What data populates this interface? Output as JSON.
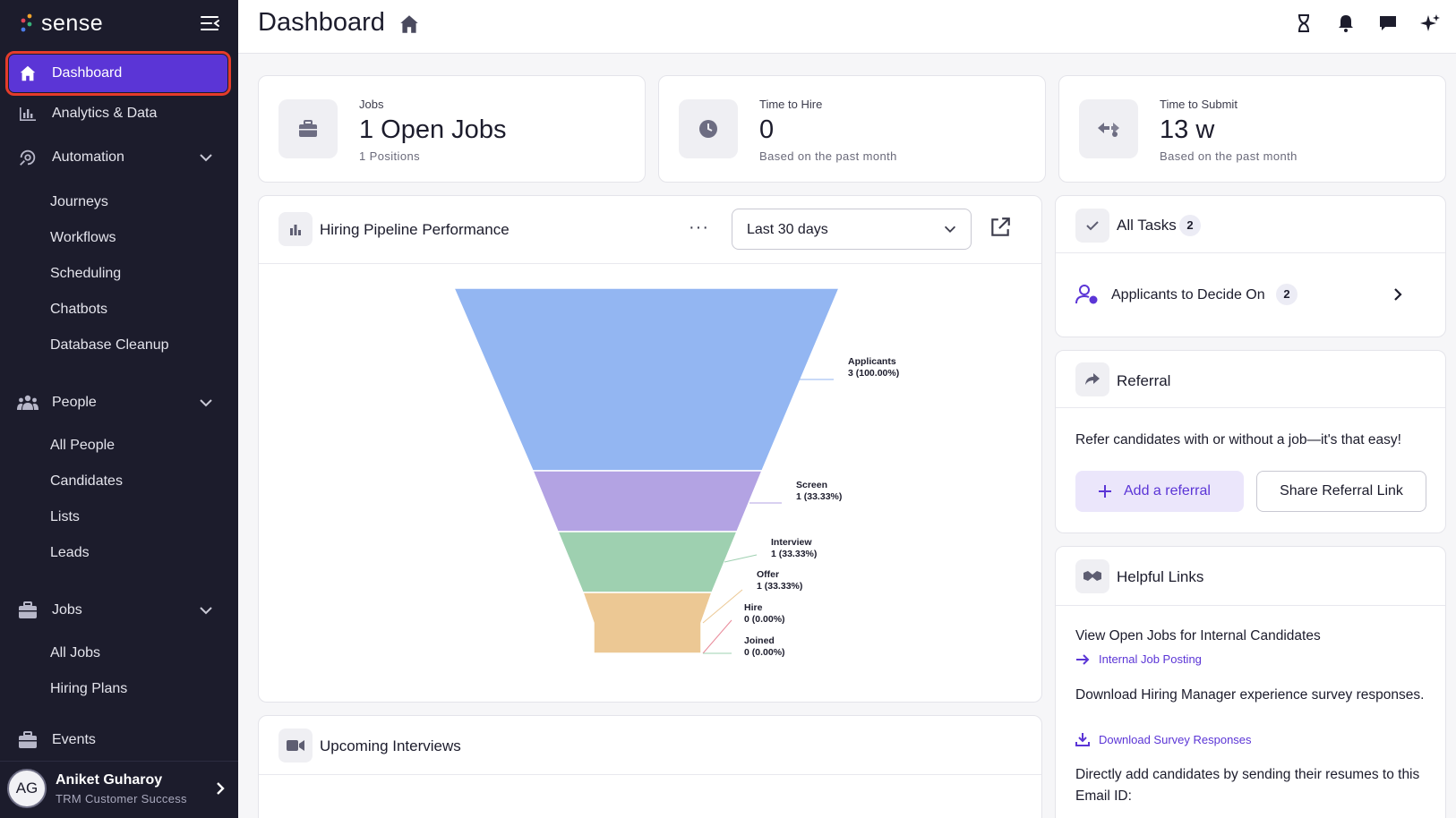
{
  "app": {
    "brand": "sense"
  },
  "sidebar": {
    "items": [
      {
        "label": "Dashboard",
        "icon": "home-icon",
        "active": true
      },
      {
        "label": "Analytics & Data",
        "icon": "bar-chart-icon"
      },
      {
        "label": "Automation",
        "icon": "automation-icon",
        "expandable": true
      },
      {
        "label": "People",
        "icon": "people-icon",
        "expandable": true
      },
      {
        "label": "Jobs",
        "icon": "briefcase-icon",
        "expandable": true
      },
      {
        "label": "Events",
        "icon": "briefcase-icon"
      }
    ],
    "automation_sub": [
      "Journeys",
      "Workflows",
      "Scheduling",
      "Chatbots",
      "Database Cleanup"
    ],
    "people_sub": [
      "All People",
      "Candidates",
      "Lists",
      "Leads"
    ],
    "jobs_sub": [
      "All Jobs",
      "Hiring Plans"
    ],
    "user": {
      "initials": "AG",
      "name": "Aniket Guharoy",
      "role": "TRM Customer Success"
    }
  },
  "header": {
    "title": "Dashboard",
    "icons": [
      "hourglass-icon",
      "bell-icon",
      "chat-icon",
      "sparkle-icon"
    ]
  },
  "stats": [
    {
      "label": "Jobs",
      "value": "1 Open Jobs",
      "sub": "1 Positions",
      "icon": "briefcase-icon"
    },
    {
      "label": "Time to Hire",
      "value": "0",
      "sub": "Based on the past month",
      "icon": "clock-icon"
    },
    {
      "label": "Time to Submit",
      "value": "13 w",
      "sub": "Based on the past month",
      "icon": "handshake-icon"
    }
  ],
  "pipeline": {
    "title": "Hiring Pipeline Performance",
    "more": "···",
    "range": "Last 30 days"
  },
  "chart_data": {
    "type": "funnel",
    "categories": [
      "Applicants",
      "Screen",
      "Interview",
      "Offer",
      "Hire",
      "Joined"
    ],
    "values": [
      3,
      1,
      1,
      1,
      0,
      0
    ],
    "labels": [
      "3 (100.00%)",
      "1 (33.33%)",
      "1 (33.33%)",
      "1 (33.33%)",
      "0 (0.00%)",
      "0 (0.00%)"
    ],
    "colors": [
      "#93b6f2",
      "#b3a3e3",
      "#9ed0b0",
      "#ecc894"
    ]
  },
  "interviews": {
    "title": "Upcoming Interviews"
  },
  "tasks": {
    "title": "All Tasks",
    "count": "2",
    "row_label": "Applicants to Decide On",
    "row_count": "2"
  },
  "referral": {
    "title": "Referral",
    "text": "Refer candidates with or without a job—it's that easy!",
    "add_label": "Add a referral",
    "share_label": "Share Referral Link"
  },
  "helpful": {
    "title": "Helpful Links",
    "items": [
      {
        "heading": "View Open Jobs for Internal Candidates",
        "link": "Internal Job Posting"
      },
      {
        "heading": "Download Hiring Manager experience survey responses.",
        "link": "Download Survey Responses"
      },
      {
        "heading": "Directly add candidates by sending their resumes to this Email ID:"
      }
    ]
  }
}
